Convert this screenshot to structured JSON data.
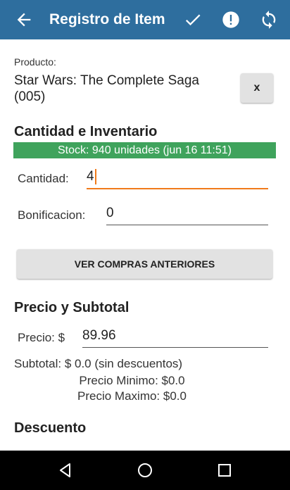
{
  "appbar": {
    "title": "Registro de Item",
    "color": "#2e6e9e"
  },
  "product": {
    "label": "Producto:",
    "name": "Star Wars: The Complete Saga (005)",
    "clear_label": "x"
  },
  "inventory": {
    "section_title": "Cantidad e Inventario",
    "stock_text": "Stock: 940 unidades (jun 16 11:51)",
    "stock_color": "#3fa35c",
    "quantity_label": "Cantidad:",
    "quantity_value": "4",
    "bonus_label": "Bonificacion:",
    "bonus_value": "0",
    "history_button": "VER COMPRAS ANTERIORES"
  },
  "pricing": {
    "section_title": "Precio y Subtotal",
    "price_label": "Precio: $",
    "price_value": "89.96",
    "subtotal_text": "Subtotal: $ 0.0 (sin descuentos)",
    "min_price_text": "Precio Minimo: $0.0",
    "max_price_text": "Precio Maximo: $0.0"
  },
  "discount": {
    "section_title": "Descuento"
  },
  "icons": [
    "back-arrow-icon",
    "check-icon",
    "alert-icon",
    "sync-icon",
    "nav-back-icon",
    "nav-home-icon",
    "nav-recents-icon"
  ]
}
